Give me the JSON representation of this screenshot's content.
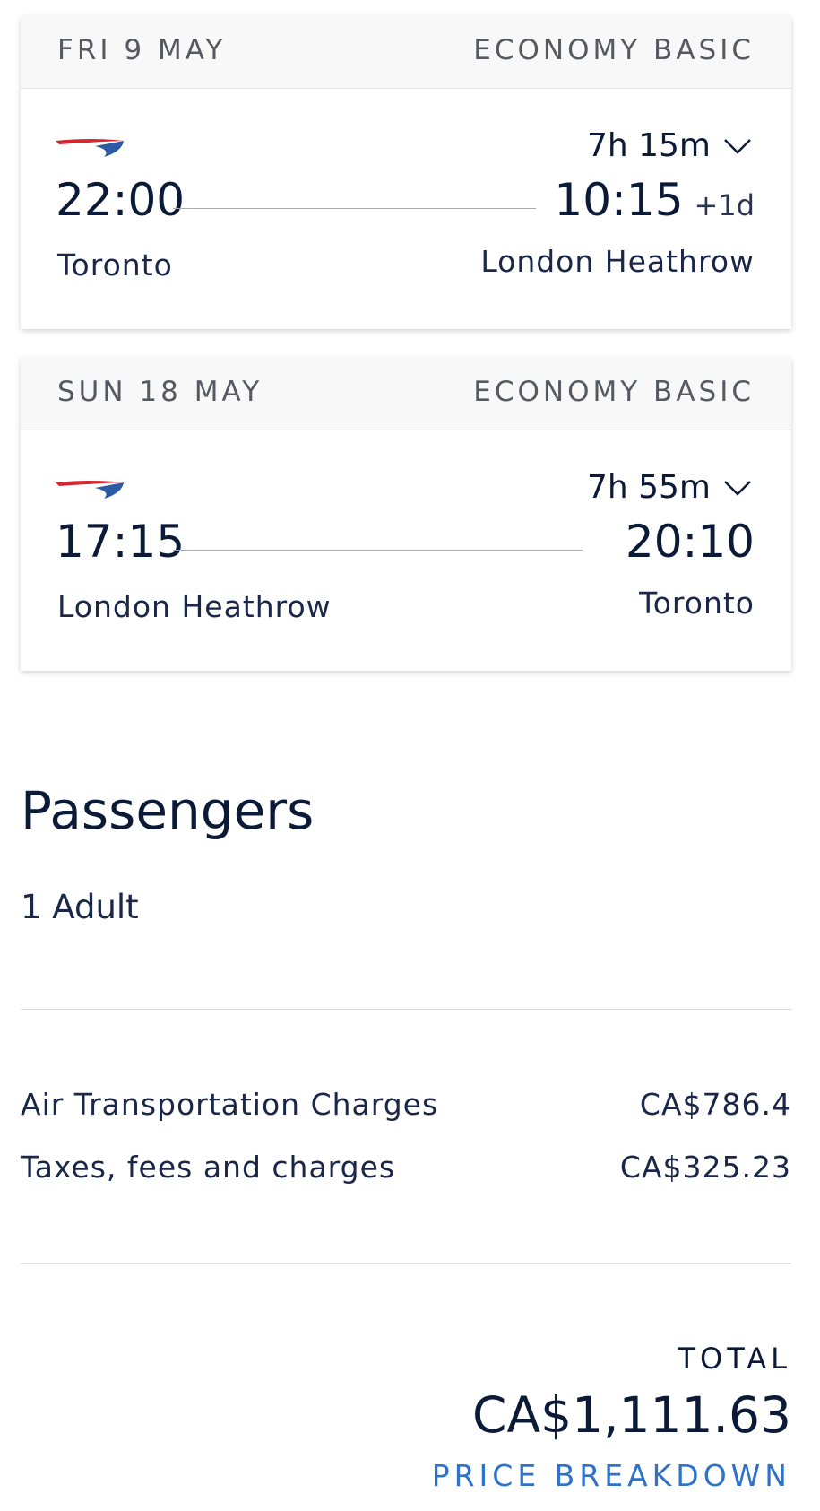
{
  "flights": [
    {
      "date": "FRI 9 MAY",
      "cabin": "ECONOMY BASIC",
      "duration": "7h 15m",
      "departure_time": "22:00",
      "arrival_time": "10:15",
      "arrival_day_offset": "+1d",
      "departure_city": "Toronto",
      "arrival_city": "London Heathrow"
    },
    {
      "date": "SUN 18 MAY",
      "cabin": "ECONOMY BASIC",
      "duration": "7h 55m",
      "departure_time": "17:15",
      "arrival_time": "20:10",
      "departure_city": "London Heathrow",
      "arrival_city": "Toronto"
    }
  ],
  "passengers": {
    "title": "Passengers",
    "count": "1 Adult"
  },
  "charges": [
    {
      "label": "Air Transportation Charges",
      "amount": "CA$786.4"
    },
    {
      "label": "Taxes, fees and charges",
      "amount": "CA$325.23"
    }
  ],
  "total": {
    "label": "TOTAL",
    "amount": "CA$1,111.63",
    "breakdown_link": "PRICE BREAKDOWN"
  },
  "icons": {
    "airline_logo": "airline-speedmarque-icon",
    "expand": "chevron-down-icon"
  },
  "colors": {
    "logo_red": "#d3282f",
    "logo_blue": "#2d5aa5",
    "link_blue": "#2e72c9",
    "text_navy": "#0b1a36"
  }
}
